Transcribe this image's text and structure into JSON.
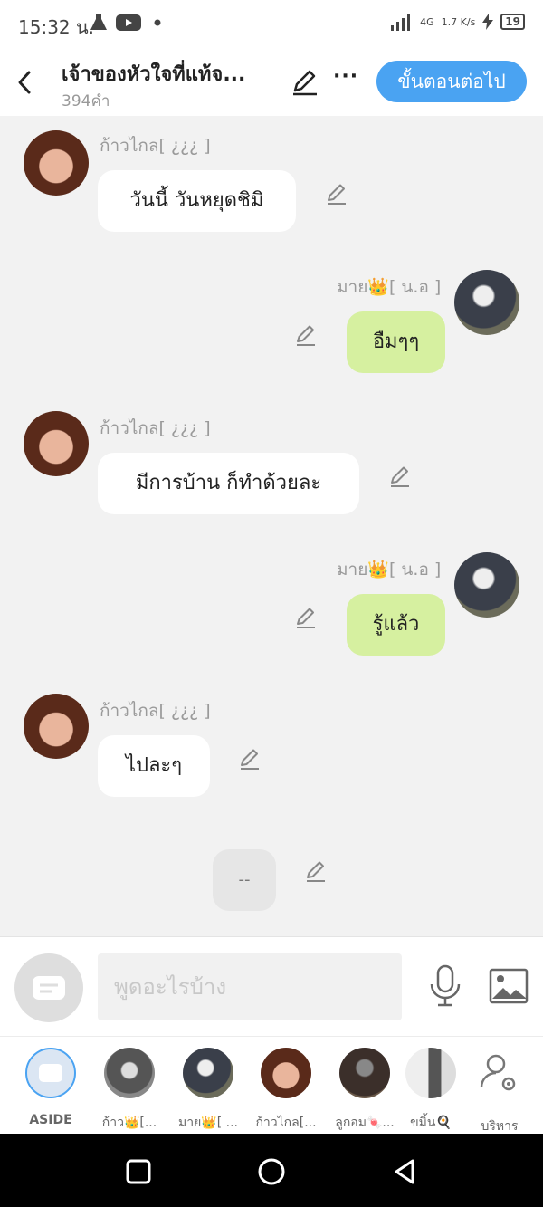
{
  "status_bar": {
    "time": "15:32 น.",
    "network": "4G",
    "speed": "1.7 K/s",
    "battery": "19"
  },
  "header": {
    "title": "เจ้าของหัวใจที่แท้จ...",
    "word_count": "394คำ",
    "next_button": "ขั้นตอนต่อไป"
  },
  "messages": [
    {
      "side": "left",
      "nickname": "ก้าวไกล[ ¿¿¿ ]",
      "text": "วันนี้ วันหยุดชิมิ"
    },
    {
      "side": "right",
      "nickname": "มาย👑[ น.อ ]",
      "text": "อืมๆๆ"
    },
    {
      "side": "left",
      "nickname": "ก้าวไกล[ ¿¿¿ ]",
      "text": "มีการบ้าน ก็ทำด้วยละ"
    },
    {
      "side": "right",
      "nickname": "มาย👑[ น.อ ]",
      "text": "รู้แล้ว"
    },
    {
      "side": "left",
      "nickname": "ก้าวไกล[ ¿¿¿ ]",
      "text": "ไปละๆ"
    },
    {
      "side": "aside",
      "text": "--"
    }
  ],
  "input": {
    "placeholder": "พูดอะไรบ้าง"
  },
  "characters": [
    {
      "label": "ASIDE"
    },
    {
      "label": "ก้าว👑[..."
    },
    {
      "label": "มาย👑[ ..."
    },
    {
      "label": "ก้าวไกล[..."
    },
    {
      "label": "ลูกอม🍬..."
    },
    {
      "label": "ขมิ้น🍳"
    },
    {
      "label": "บริหาร"
    }
  ],
  "colors": {
    "accent": "#4aa3f2",
    "own_bubble": "#d6f0a0",
    "other_bubble": "#ffffff",
    "background": "#f2f2f2"
  }
}
